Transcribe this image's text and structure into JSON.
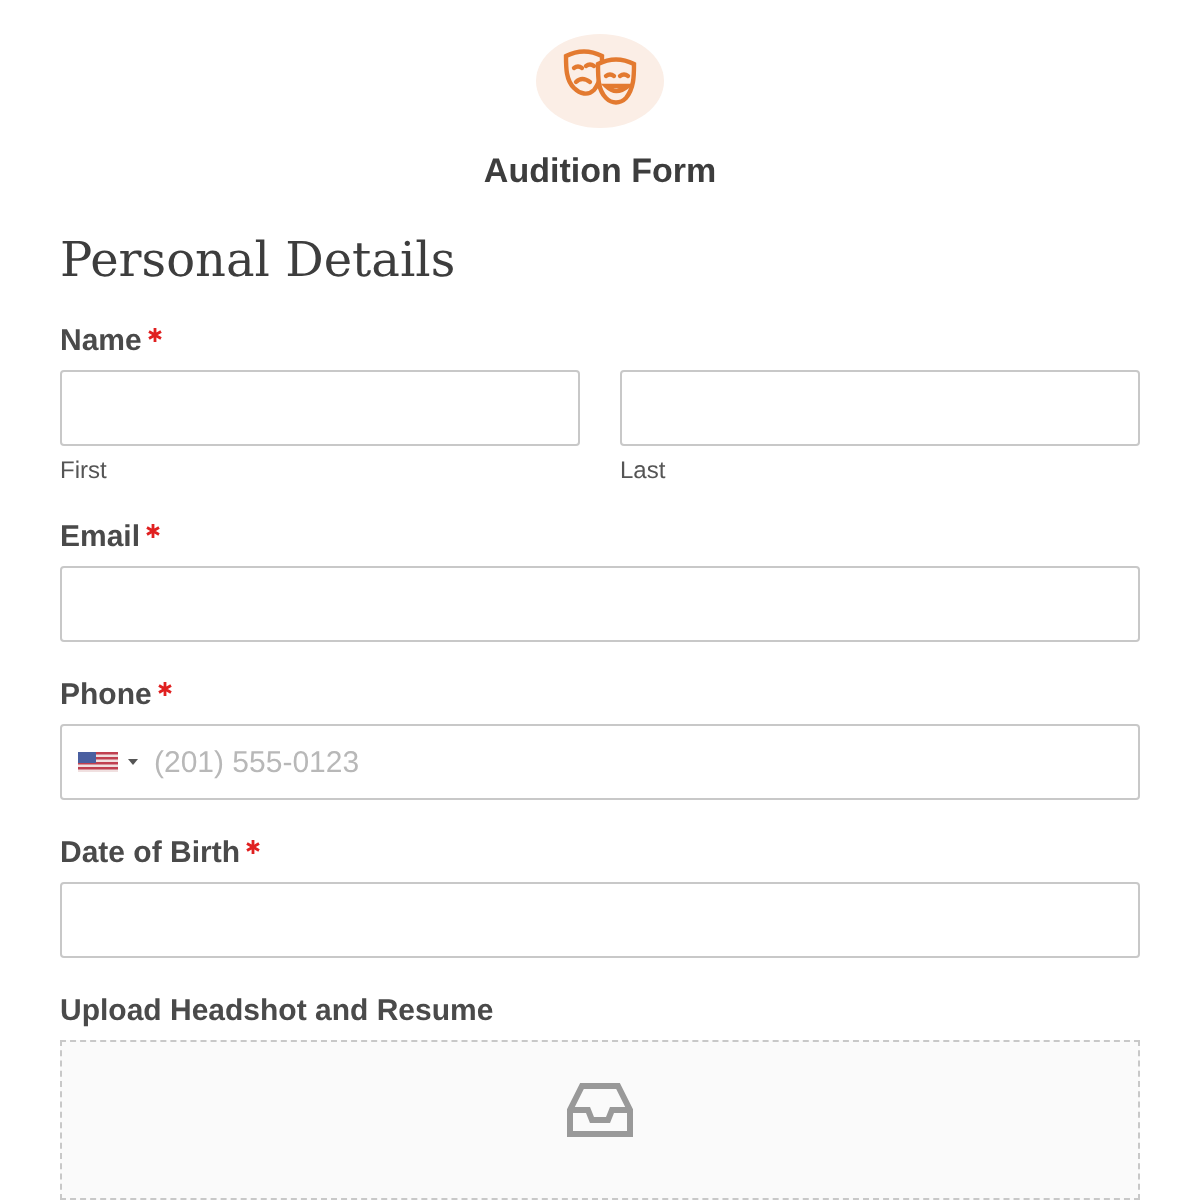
{
  "form": {
    "title": "Audition Form"
  },
  "section": {
    "heading": "Personal Details"
  },
  "fields": [
    {
      "kind": "name",
      "label": "Name",
      "required": true,
      "parts": [
        {
          "caption": "First"
        },
        {
          "caption": "Last"
        }
      ]
    },
    {
      "kind": "text",
      "label": "Email",
      "required": true
    },
    {
      "kind": "phone",
      "label": "Phone",
      "required": true,
      "placeholder": "(201) 555-0123"
    },
    {
      "kind": "text",
      "label": "Date of Birth",
      "required": true
    },
    {
      "kind": "upload",
      "label": "Upload Headshot and Resume",
      "required": false
    }
  ]
}
